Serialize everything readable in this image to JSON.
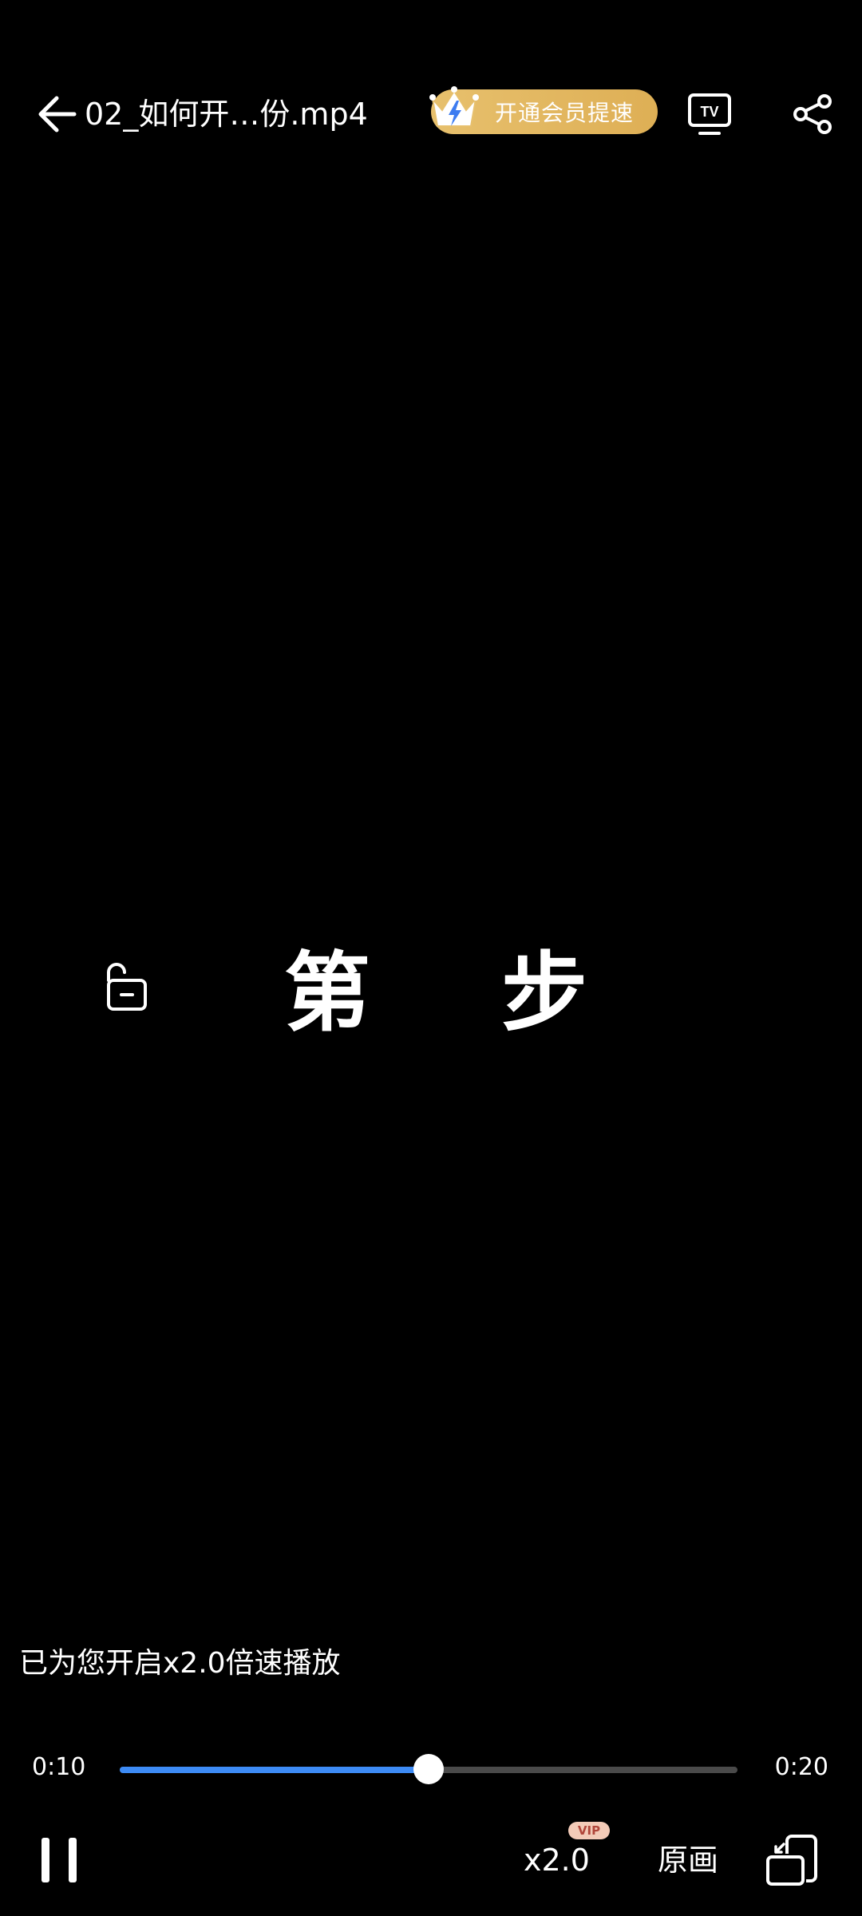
{
  "header": {
    "title": "02_如何开…份.mp4",
    "vip_promo_label": "开通会员提速",
    "tv_label": "TV"
  },
  "video": {
    "caption_left": "第",
    "caption_right": "步",
    "speed_toast": "已为您开启x2.0倍速播放"
  },
  "progress": {
    "current_time": "0:10",
    "total_time": "0:20",
    "played_fraction": 0.5
  },
  "controls": {
    "speed_label": "x2.0",
    "speed_badge": "VIP",
    "quality_label": "原画"
  },
  "colors": {
    "progress_fill": "#3d8bf5",
    "vip_pill": "#deaf55"
  }
}
